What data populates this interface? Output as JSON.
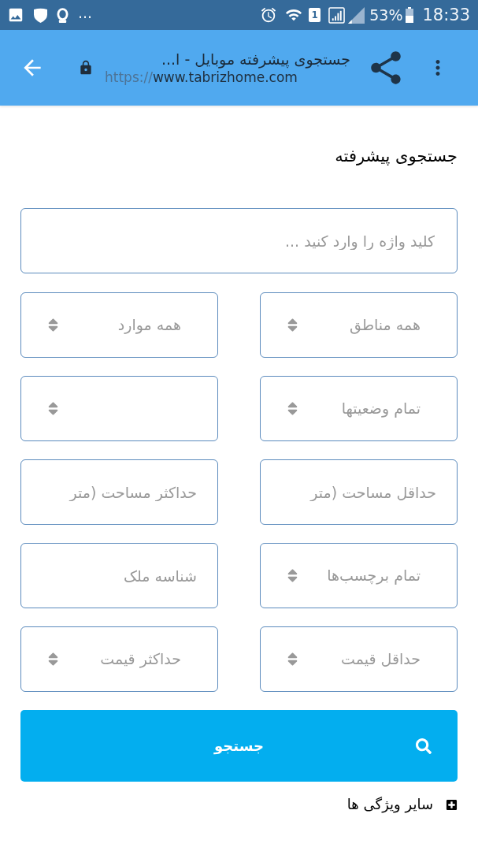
{
  "status_bar": {
    "overflow_dots": "...",
    "sim_badge": "1",
    "battery_percent": "53%",
    "time": "18:33"
  },
  "toolbar": {
    "title": "جستجوی پیشرفته موبایل - ا...",
    "url_scheme": "https://",
    "url_host": "www.tabrizhome.com"
  },
  "heading": "جستجوی پیشرفته",
  "keyword_field": {
    "placeholder": "کلید واژه را وارد کنید ..."
  },
  "fields": [
    {
      "kind": "select",
      "value": "همه مناطق"
    },
    {
      "kind": "select",
      "value": "همه موارد"
    },
    {
      "kind": "select",
      "value": "تمام وضعیتها"
    },
    {
      "kind": "select"
    },
    {
      "kind": "input",
      "placeholder": "حداقل مساحت (متر"
    },
    {
      "kind": "input",
      "placeholder": "حداکثر مساحت (متر"
    },
    {
      "kind": "select",
      "value": "تمام برچسب‌ها"
    },
    {
      "kind": "input",
      "placeholder": "شناسه ملک"
    },
    {
      "kind": "select",
      "value": "حداقل قیمت"
    },
    {
      "kind": "select",
      "value": "حداکثر قیمت"
    }
  ],
  "search_button": {
    "label": "جستجو"
  },
  "more_features": {
    "label": "سایر ویژگی ها"
  }
}
